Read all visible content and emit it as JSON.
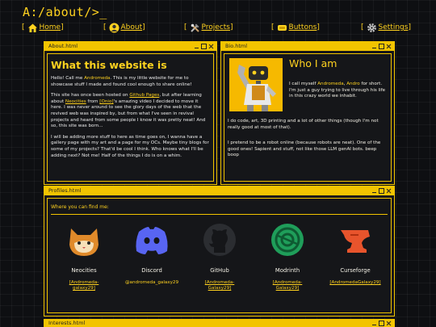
{
  "site": {
    "title": "A:/about/>_"
  },
  "nav": [
    {
      "label": "Home",
      "bracket_open": "[",
      "bracket_close": "]"
    },
    {
      "label": "About",
      "bracket_open": "[",
      "bracket_close": "]"
    },
    {
      "label": "Projects",
      "bracket_open": "[",
      "bracket_close": "]"
    },
    {
      "label": "Buttons",
      "bracket_open": "[",
      "bracket_close": "]"
    },
    {
      "label": "Settings",
      "bracket_open": "[",
      "bracket_close": "]"
    }
  ],
  "about_window": {
    "title": "About.html",
    "heading": "What this website is",
    "p1": {
      "a": "Hello! Call me ",
      "b": "Andromeda",
      "c": ". This is my little website for me to showcase stuff I made and found cool enough to share online!"
    },
    "p2": {
      "a": "This site has once been hosted on ",
      "b": "Github Pages",
      "c": ", but after learning about ",
      "d": "Neocities",
      "e": " from ",
      "f": "[Onio]",
      "g": "'s amazing video I decided to move it here. I was never around to see the glory days of the web that the revived web was inspired by, but from what I've seen in revival projects and heard from some people I know it was pretty neat! And so, this site was born..."
    },
    "p3": "I will be adding more stuff to here as time goes on, I wanna have a gallery page with my art and a page for my OCs. Maybe tiny blogs for some of my projects? That'd be cool I think. Who knows what I'll be adding next? Not me! Half of the things I do is on a whim."
  },
  "bio_window": {
    "title": "Bio.html",
    "heading": "Who I am",
    "p1": {
      "a": "I call myself ",
      "b": "Andromeda",
      "c": ", ",
      "d": "Andro",
      "e": " for short. I'm just a guy trying to live through his life in this crazy world we inhabit."
    },
    "p2": "I do code, art, 3D printing and a lot of other things (though I'm not really good at most of that).",
    "p3": "I pretend to be a robot online (because robots are neat). One of the good ones! Sapient and stuff, not like those LLM genAI bots. beep boop"
  },
  "profiles_window": {
    "title": "Profiles.html",
    "subtitle": "Where you can find me:",
    "items": [
      {
        "name": "Neocities",
        "handle_l1": "[Andromeda-",
        "handle_l2": "galaxy29]",
        "icon": "neocities-cat-icon"
      },
      {
        "name": "Discord",
        "handle_l1": "@andromeda_galaxy29",
        "handle_l2": "",
        "icon": "discord-icon"
      },
      {
        "name": "GitHub",
        "handle_l1": "[Andromeda-",
        "handle_l2": "Galaxy29]",
        "icon": "github-icon"
      },
      {
        "name": "Modrinth",
        "handle_l1": "[Andromeda-",
        "handle_l2": "Galaxy29]",
        "icon": "modrinth-icon"
      },
      {
        "name": "Curseforge",
        "handle_l1": "[AndromedaGalaxy29]",
        "handle_l2": "",
        "icon": "curseforge-icon"
      }
    ]
  },
  "interests_window": {
    "title": "Interests.html"
  },
  "colors": {
    "accent": "#ffd21f",
    "frame": "#f2c400",
    "background": "#0e0f12",
    "panel": "#151619"
  }
}
